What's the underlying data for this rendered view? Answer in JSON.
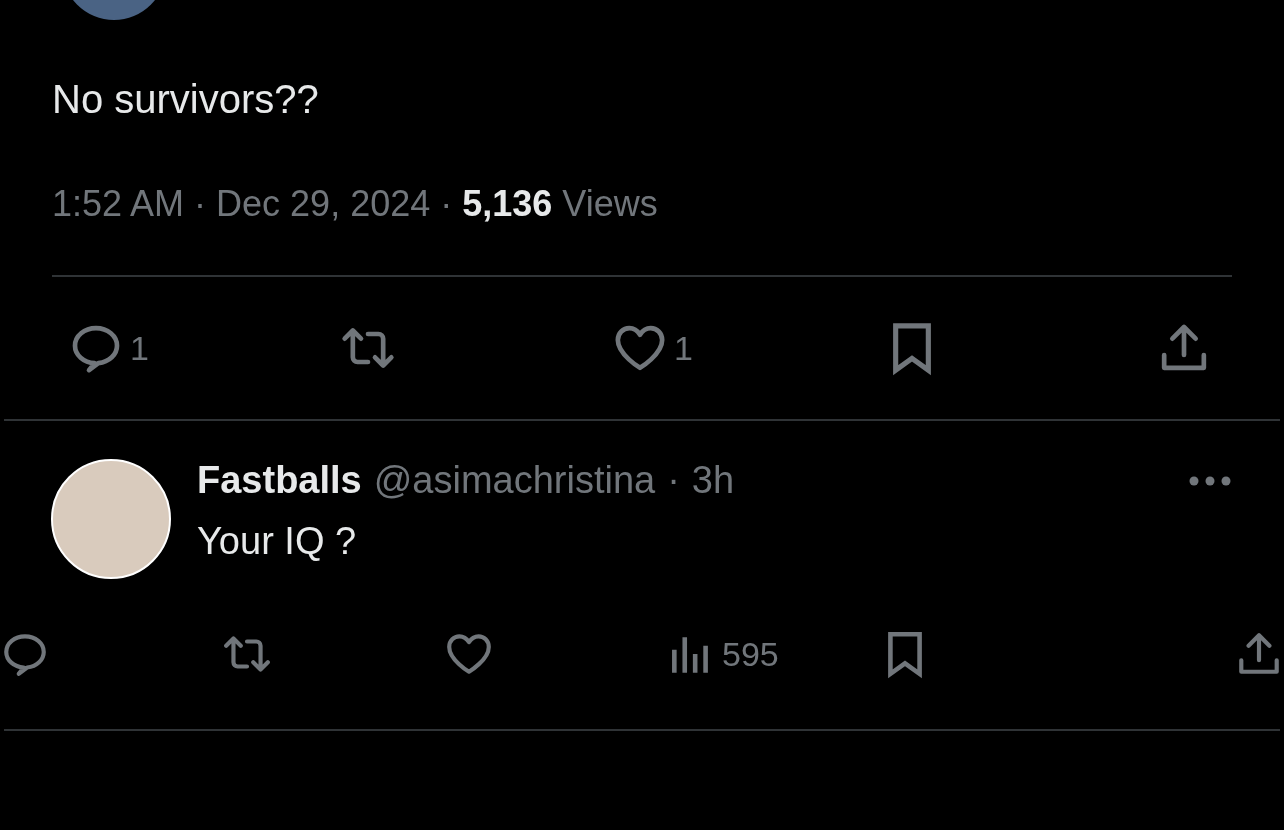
{
  "tweet": {
    "text": "No survivors??",
    "meta": "1:52 AM · Dec 29, 2024 · **5,136** Views",
    "actions": [
      {
        "kind": "reply",
        "count": "1"
      },
      {
        "kind": "retweet"
      },
      {
        "kind": "like",
        "count": "1"
      },
      {
        "kind": "bookmark"
      },
      {
        "kind": "share"
      }
    ]
  },
  "reply": {
    "name": "Fastballs",
    "handle": "@asimachristina",
    "separator": "·",
    "time": "3h",
    "text": "Your IQ ?",
    "actions": [
      {
        "kind": "reply"
      },
      {
        "kind": "retweet"
      },
      {
        "kind": "like"
      },
      {
        "kind": "views",
        "count": "595"
      },
      {
        "kind": "bookmark"
      },
      {
        "kind": "share"
      }
    ]
  }
}
